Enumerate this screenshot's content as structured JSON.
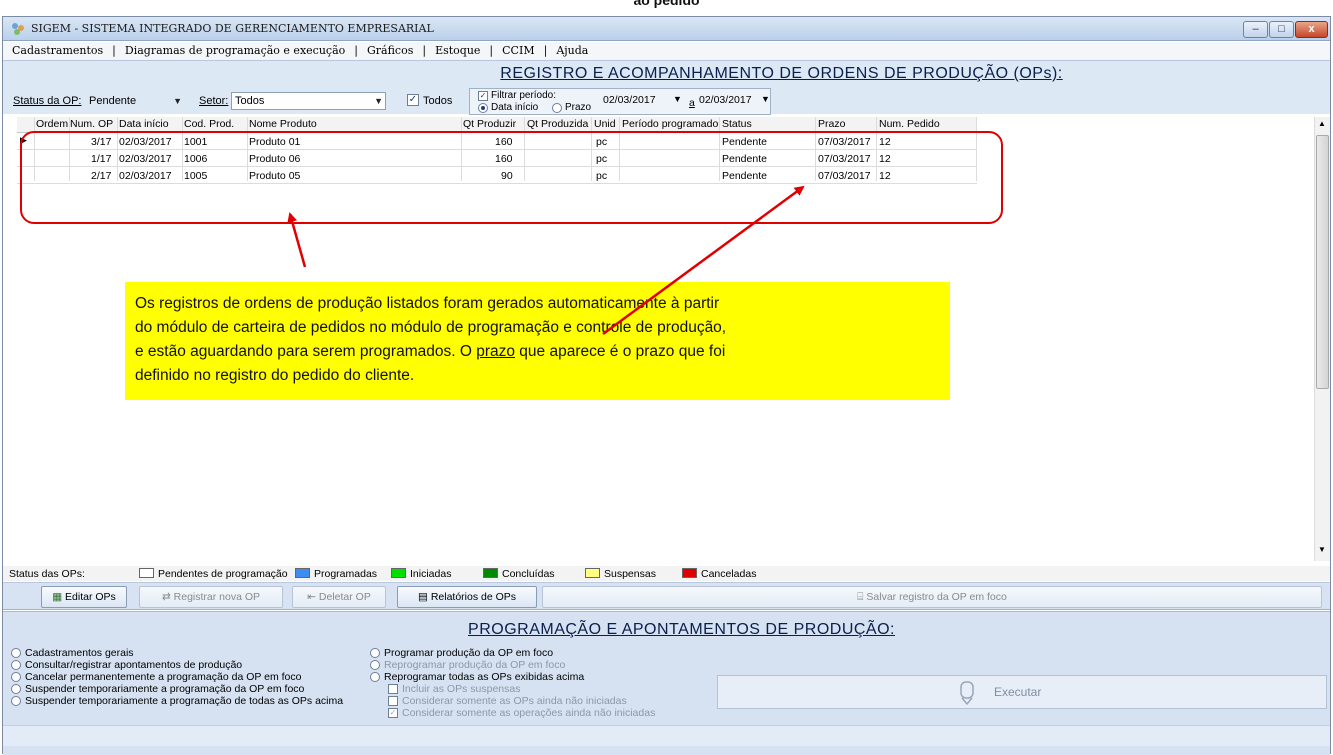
{
  "top_caption": "ao pedido",
  "window": {
    "title": "SIGEM - SISTEMA INTEGRADO DE GERENCIAMENTO EMPRESARIAL",
    "controls": {
      "minimize": "–",
      "maximize": "□",
      "close": "x"
    }
  },
  "menu": [
    "Cadastramentos",
    "Diagramas de programação e execução",
    "Gráficos",
    "Estoque",
    "CCIM",
    "Ajuda"
  ],
  "top_section": {
    "title": "REGISTRO E ACOMPANHAMENTO DE ORDENS DE PRODUÇÃO (OPs):",
    "status_label": "Status da OP:",
    "status_value": "Pendente",
    "setor_label": "Setor:",
    "setor_value": "Todos",
    "todos_label": "Todos",
    "todos_checked": true,
    "filtrar_label": "Filtrar período:",
    "filtrar_checked": true,
    "radio_data_inicio": "Data início",
    "radio_prazo": "Prazo",
    "date_from": "02/03/2017",
    "date_sep": "a",
    "date_to": "02/03/2017"
  },
  "grid": {
    "columns": [
      "Ordem",
      "Num. OP",
      "Data início",
      "Cod. Prod.",
      "Nome Produto",
      "Qt Produzir",
      "Qt Produzida",
      "Unid",
      "Período programado",
      "Status",
      "Prazo",
      "Num. Pedido"
    ],
    "rows": [
      {
        "ordem": "",
        "num_op": "3/17",
        "data_inicio": "02/03/2017",
        "cod_prod": "1001",
        "nome": "Produto 01",
        "qt_produzir": "160",
        "qt_produzida": "",
        "unid": "pc",
        "periodo": "",
        "status": "Pendente",
        "prazo": "07/03/2017",
        "num_pedido": "12"
      },
      {
        "ordem": "",
        "num_op": "1/17",
        "data_inicio": "02/03/2017",
        "cod_prod": "1006",
        "nome": "Produto 06",
        "qt_produzir": "160",
        "qt_produzida": "",
        "unid": "pc",
        "periodo": "",
        "status": "Pendente",
        "prazo": "07/03/2017",
        "num_pedido": "12"
      },
      {
        "ordem": "",
        "num_op": "2/17",
        "data_inicio": "02/03/2017",
        "cod_prod": "1005",
        "nome": "Produto 05",
        "qt_produzir": "90",
        "qt_produzida": "",
        "unid": "pc",
        "periodo": "",
        "status": "Pendente",
        "prazo": "07/03/2017",
        "num_pedido": "12"
      }
    ]
  },
  "annotation": {
    "line1": "Os registros de ordens de produção listados foram gerados automaticamente à partir",
    "line2": "do módulo de carteira de pedidos no módulo de programação e controle de produção,",
    "line3_pre": "e estão aguardando para serem programados. O ",
    "line3_u": "prazo",
    "line3_post": " que aparece é o prazo que foi",
    "line4": "definido no registro do pedido do cliente."
  },
  "legend": {
    "label": "Status das OPs:",
    "items": [
      {
        "label": "Pendentes de programação",
        "color": "#ffffff"
      },
      {
        "label": "Programadas",
        "color": "#3d8cf0"
      },
      {
        "label": "Iniciadas",
        "color": "#00e000"
      },
      {
        "label": "Concluídas",
        "color": "#008a00"
      },
      {
        "label": "Suspensas",
        "color": "#ffff80"
      },
      {
        "label": "Canceladas",
        "color": "#e00000"
      }
    ]
  },
  "toolbar": {
    "editar": "Editar OPs",
    "registrar": "Registrar nova OP",
    "deletar": "Deletar OP",
    "relatorios": "Relatórios de OPs",
    "salvar": "Salvar registro da OP em foco"
  },
  "bottom_section": {
    "title": "PROGRAMAÇÃO E APONTAMENTOS DE PRODUÇÃO:",
    "left_options": [
      "Cadastramentos gerais",
      "Consultar/registrar apontamentos de produção",
      "Cancelar permanentemente a programação da OP em foco",
      "Suspender temporariamente a programação da OP em foco",
      "Suspender temporariamente a programação de todas as OPs acima"
    ],
    "mid_options": [
      "Programar produção da OP em foco",
      "Reprogramar produção da OP em foco",
      "Reprogramar todas as OPs exibidas acima"
    ],
    "sub_checks": [
      "Incluir as OPs suspensas",
      "Considerar somente as OPs ainda não iniciadas",
      "Considerar somente as operações ainda não iniciadas"
    ],
    "execute": "Executar"
  },
  "colors": {
    "annotation_bg": "#ffff00",
    "highlight_red": "#e00000",
    "panel_bg": "#dde8f5"
  }
}
